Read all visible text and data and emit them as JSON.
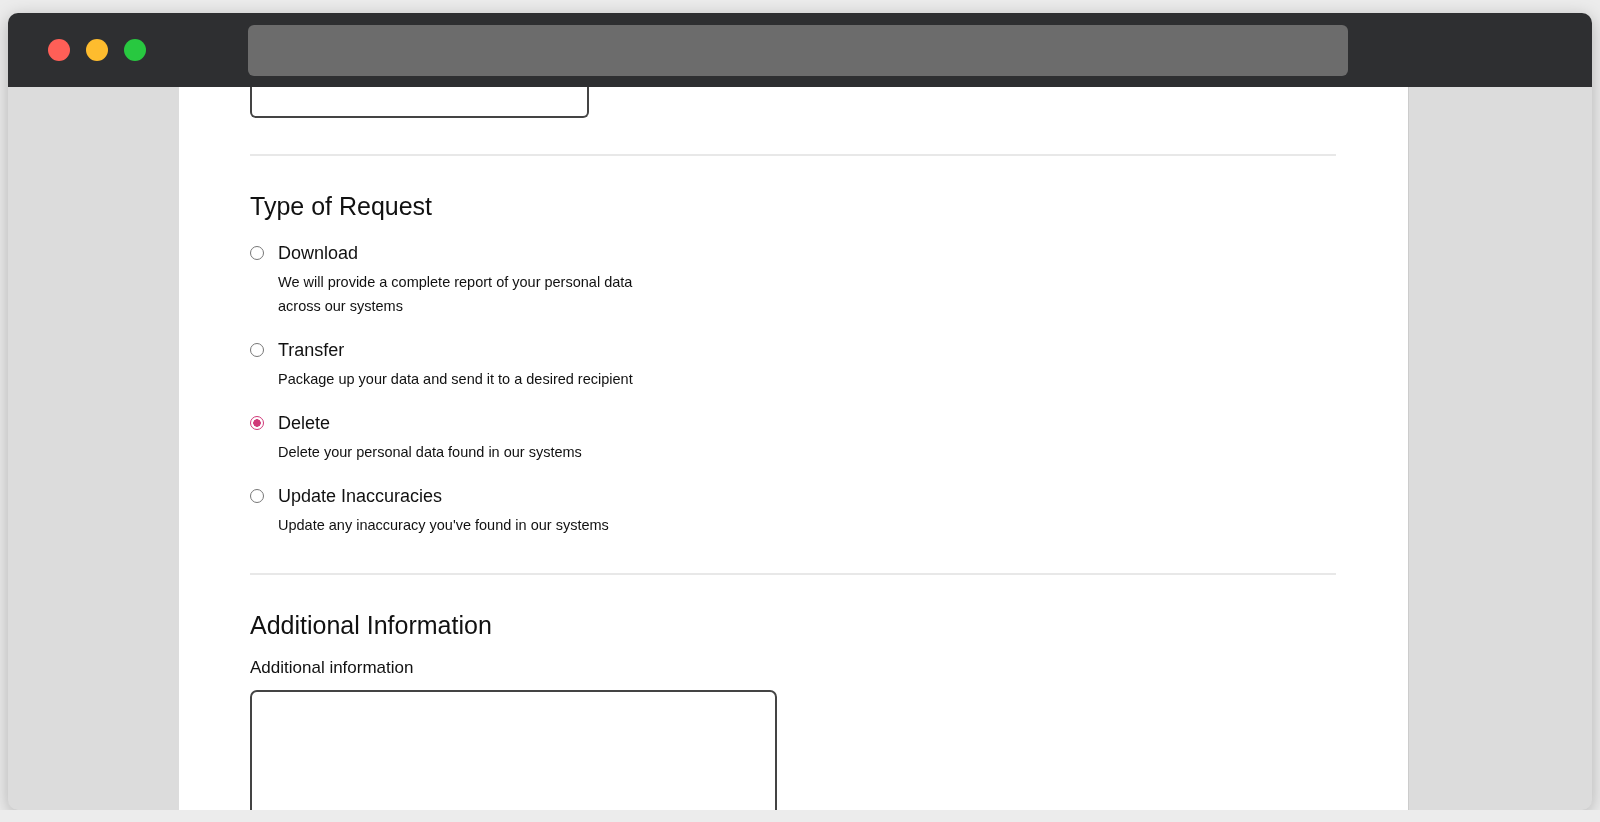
{
  "sections": [
    {
      "title": "Type of Request",
      "kind": "radio-group",
      "options": [
        {
          "label": "Download",
          "description": "We will provide a complete report of your personal data across our systems",
          "selected": false
        },
        {
          "label": "Transfer",
          "description": "Package up your data and send it to a desired recipient",
          "selected": false
        },
        {
          "label": "Delete",
          "description": "Delete your personal data found in our systems",
          "selected": true
        },
        {
          "label": "Update Inaccuracies",
          "description": "Update any inaccuracy you've found in our systems",
          "selected": false
        }
      ]
    },
    {
      "title": "Additional Information",
      "kind": "textarea",
      "field_label": "Additional information"
    }
  ]
}
